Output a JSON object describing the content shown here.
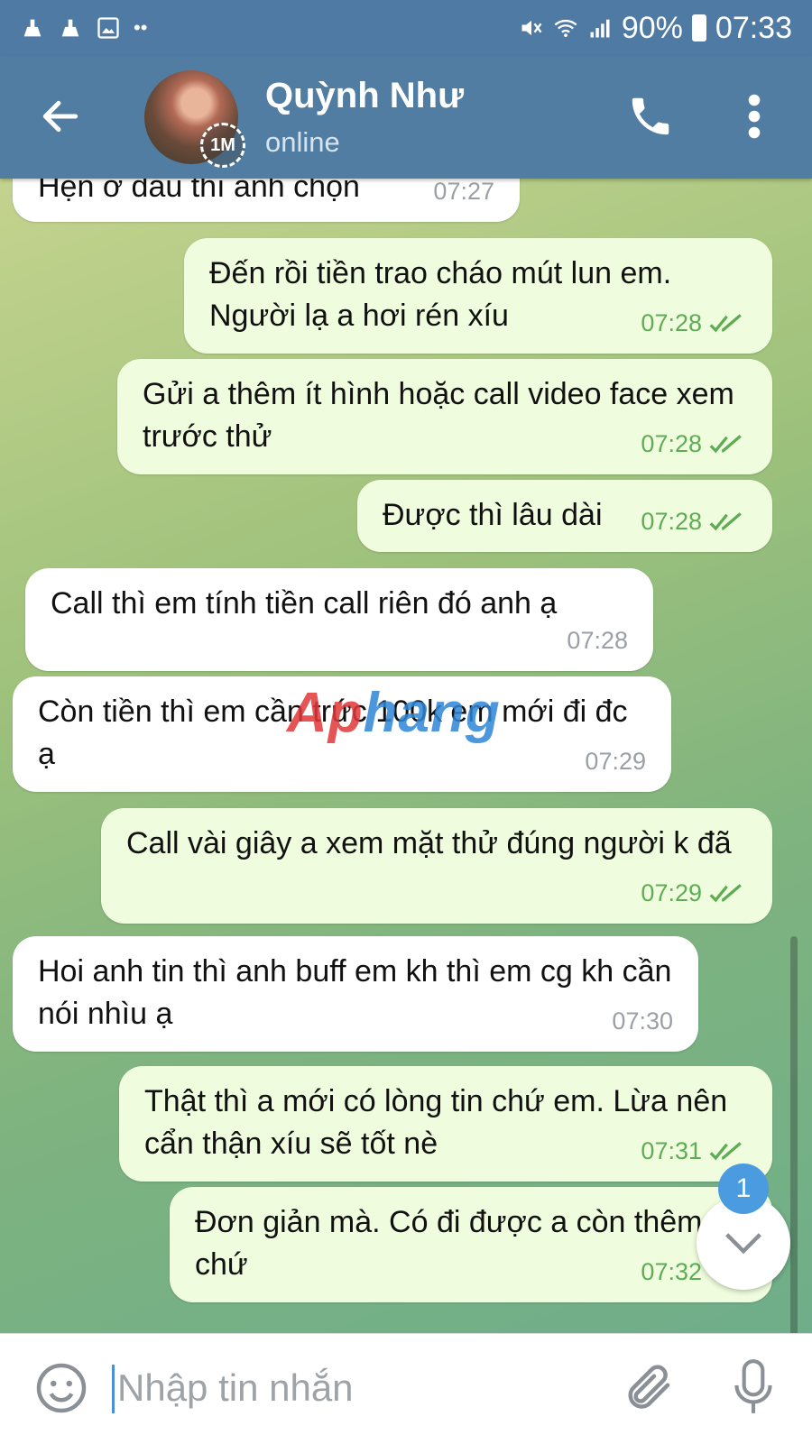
{
  "status_bar": {
    "battery": "90%",
    "time": "07:33"
  },
  "header": {
    "title": "Quỳnh Như",
    "status": "online",
    "avatar_badge": "1M"
  },
  "messages": [
    {
      "text": "Hẹn ở đâu thì anh chọn",
      "time": "07:27",
      "direction": "in"
    },
    {
      "text": "Đến rồi tiền trao cháo mút lun em. Người lạ a hơi rén xíu",
      "time": "07:28",
      "direction": "out"
    },
    {
      "text": "Gửi a thêm ít hình hoặc call video face xem trước thử",
      "time": "07:28",
      "direction": "out"
    },
    {
      "text": "Được thì lâu dài",
      "time": "07:28",
      "direction": "out"
    },
    {
      "text": "Call thì em tính tiền call riên đó anh ạ",
      "time": "07:28",
      "direction": "in"
    },
    {
      "text": "Còn tiền thì em cần trức 100k em mới đi đc ạ",
      "time": "07:29",
      "direction": "in"
    },
    {
      "text": "Call vài giây a xem mặt thử đúng người k đã",
      "time": "07:29",
      "direction": "out"
    },
    {
      "text": "Hoi anh tin thì anh buff em kh thì em cg kh cần nói nhìu ạ",
      "time": "07:30",
      "direction": "in"
    },
    {
      "text": "Thật thì a mới có lòng tin chứ em. Lừa nên cẩn thận xíu sẽ tốt nè",
      "time": "07:31",
      "direction": "out"
    },
    {
      "text": "Đơn giản mà. Có đi được a còn thêm á chứ",
      "time": "07:32",
      "direction": "out"
    }
  ],
  "watermark": {
    "part1": "Ap",
    "part2": "hang"
  },
  "unread_badge": "1",
  "composer": {
    "placeholder": "Nhập tin nhắn"
  },
  "colors": {
    "header": "#517da2",
    "outgoing_bubble": "#effdde",
    "incoming_bubble": "#ffffff",
    "check": "#5fac55",
    "badge": "#4b9be0"
  },
  "icons": [
    "back-arrow-icon",
    "phone-icon",
    "more-vert-icon",
    "emoji-icon",
    "attach-icon",
    "mic-icon",
    "chevron-down-icon"
  ]
}
